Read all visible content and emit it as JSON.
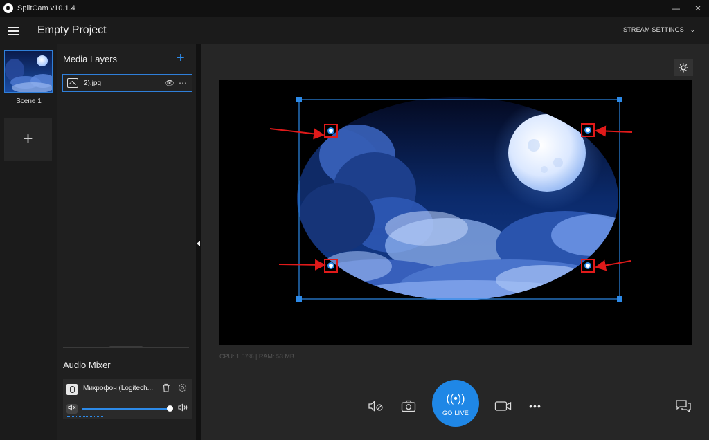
{
  "window": {
    "title": "SplitCam v10.1.4",
    "minimize": "—",
    "close": "✕"
  },
  "header": {
    "project_title": "Empty Project",
    "stream_settings": "STREAM SETTINGS",
    "chevron": "⌄"
  },
  "scenes": {
    "items": [
      {
        "label": "Scene 1"
      }
    ],
    "add_label": "+"
  },
  "layers": {
    "title": "Media Layers",
    "add_label": "+",
    "items": [
      {
        "name": "2).jpg",
        "visibility": "👁",
        "more": "⋯"
      }
    ]
  },
  "audio_mixer": {
    "title": "Audio Mixer",
    "devices": [
      {
        "name": "Микрофон (Logitech...",
        "volume": 0.95,
        "muted": false
      }
    ]
  },
  "preview": {
    "status_text": "CPU: 1.57% | RAM: 53 MB",
    "layer_image": "moon-clouds-night"
  },
  "toolbar": {
    "go_live_label": "GO LIVE",
    "go_live_icon": "((•))",
    "more": "•••"
  },
  "colors": {
    "accent": "#1f87e6",
    "selection": "#2f7fd9",
    "annotation": "#e01a1a"
  }
}
